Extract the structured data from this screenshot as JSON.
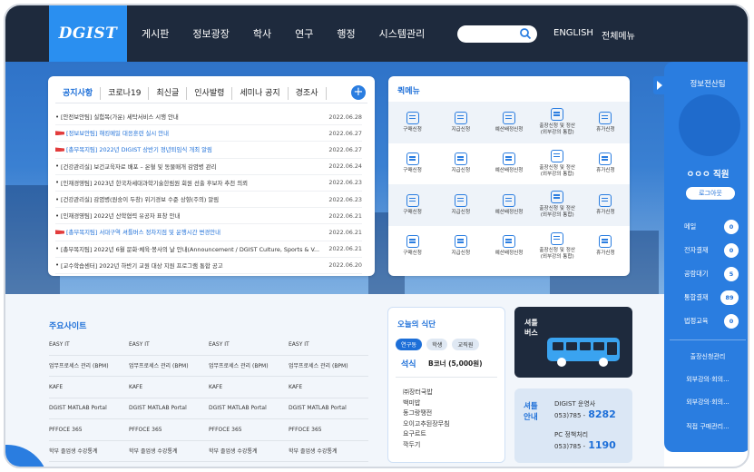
{
  "header": {
    "logo": "DGIST",
    "nav": [
      "게시판",
      "정보광장",
      "학사",
      "연구",
      "행정",
      "시스템관리"
    ],
    "search_placeholder": "",
    "links": [
      "ENGLISH",
      "전체메뉴"
    ]
  },
  "notice": {
    "tabs": [
      "공지사항",
      "코로나19",
      "최신글",
      "인사발령",
      "세미나 공지",
      "경조사"
    ],
    "active_tab": "공지사항",
    "items": [
      {
        "title": "[안전보안팀] 실험복(가운) 세탁서비스 시행 안내",
        "date": "2022.06.28",
        "flag": false,
        "hot": false
      },
      {
        "title": "[정보보안팀] 해킹메일 대응훈련 실시 안내",
        "date": "2022.06.27",
        "flag": true,
        "hot": true
      },
      {
        "title": "[총무복지팀] 2022년 DIGIST 상반기 정년퇴임식 개최 알림",
        "date": "2022.06.27",
        "flag": true,
        "hot": true
      },
      {
        "title": "[건강관리실] 보건교육자료 배포 – 온혈 및 동물매개 감염병 관리",
        "date": "2022.06.24",
        "flag": false,
        "hot": false
      },
      {
        "title": "[인재경영팀] 2023년 한국차세대과학기술한림원 회원 선출 후보자 추천 의뢰",
        "date": "2022.06.23",
        "flag": false,
        "hot": false
      },
      {
        "title": "[건강관리실] 감염병(원숭이 두창) 위기경보 수준 상향(주의) 알림",
        "date": "2022.06.23",
        "flag": false,
        "hot": false
      },
      {
        "title": "[인재경영팀] 2022년 산학협력 유공자 표창 안내",
        "date": "2022.06.21",
        "flag": false,
        "hot": false
      },
      {
        "title": "[총무복지팀] 서대구역 셔틀버스 정차지점 및 운행시간 변경안내",
        "date": "2022.06.21",
        "flag": true,
        "hot": true
      },
      {
        "title": "[총무복지팀] 2022년 6월 문화·체육·봉사의 날 안내(Announcement / DGIST Culture, Sports & V...",
        "date": "2022.06.21",
        "flag": false,
        "hot": false
      },
      {
        "title": "[교수학습센터] 2022년 하반기 교원 대상 지원 프로그램 통합 공고",
        "date": "2022.06.20",
        "flag": false,
        "hot": false
      }
    ]
  },
  "quick": {
    "title": "퀵메뉴",
    "rows": [
      [
        "구매신청",
        "지급신청",
        "예산배정신청",
        "출장신청 및 정산\n(외부강의 통합)",
        "휴가신청"
      ],
      [
        "구매신청",
        "지급신청",
        "예산배정신청",
        "출장신청 및 정산\n(외부강의 통합)",
        "휴가신청"
      ],
      [
        "구매신청",
        "지급신청",
        "예산배정신청",
        "출장신청 및 정산\n(외부강의 통합)",
        "휴가신청"
      ],
      [
        "구매신청",
        "지급신청",
        "예산배정신청",
        "출장신청 및 정산\n(외부강의 통합)",
        "휴가신청"
      ]
    ]
  },
  "sidebar": {
    "title": "정보전산팀",
    "user": "ㅇㅇㅇ 직원",
    "logout": "로그아웃",
    "counters": [
      {
        "label": "메일",
        "count": "0"
      },
      {
        "label": "전자결재",
        "count": "0"
      },
      {
        "label": "공람대기",
        "count": "5"
      },
      {
        "label": "통합결재",
        "count": "89"
      },
      {
        "label": "법정교육",
        "count": "0"
      }
    ],
    "links": [
      "출장신청관리",
      "외부강의·회의...",
      "외부강의·회의...",
      "직접 구매관리..."
    ]
  },
  "sites": {
    "title": "주요사이트",
    "rows": [
      [
        "EASY IT",
        "EASY IT",
        "EASY IT",
        "EASY IT"
      ],
      [
        "업무프로세스 관리 (BPM)",
        "업무프로세스 관리 (BPM)",
        "업무프로세스 관리 (BPM)",
        "업무프로세스 관리 (BPM)"
      ],
      [
        "KAFE",
        "KAFE",
        "KAFE",
        "KAFE"
      ],
      [
        "DGIST MATLAB Portal",
        "DGIST MATLAB Portal",
        "DGIST MATLAB Portal",
        "DGIST MATLAB Portal"
      ],
      [
        "PFFOCE 365",
        "PFFOCE 365",
        "PFFOCE 365",
        "PFFOCE 365"
      ],
      [
        "학부 졸업생 수강통계",
        "학부 졸업생 수강통계",
        "학부 졸업생 수강통계",
        "학부 졸업생 수강통계"
      ]
    ]
  },
  "meal": {
    "title": "오늘의 식단",
    "tabs": [
      "연구동",
      "학생",
      "교직원"
    ],
    "active_tab": "연구동",
    "kind": "석식",
    "place": "B코너 (5,000원)",
    "menu": [
      "㈜장터국밥",
      "백미밥",
      "동그랑땡전",
      "오이고추된장무침",
      "요구르트",
      "깍두기"
    ]
  },
  "bus": {
    "title": "셔틀\n버스"
  },
  "phone": {
    "title": "셔틀\n안내",
    "entries": [
      {
        "label": "DIGIST 운영사",
        "prefix": "053)785 -",
        "number": "8282"
      },
      {
        "label": "PC 정책처리",
        "prefix": "053)785 -",
        "number": "1190"
      }
    ]
  },
  "colors": {
    "navy": "#1e2a3d",
    "accent": "#2a7de0",
    "link": "#1d6fd8",
    "flag": "#e23c3c"
  }
}
